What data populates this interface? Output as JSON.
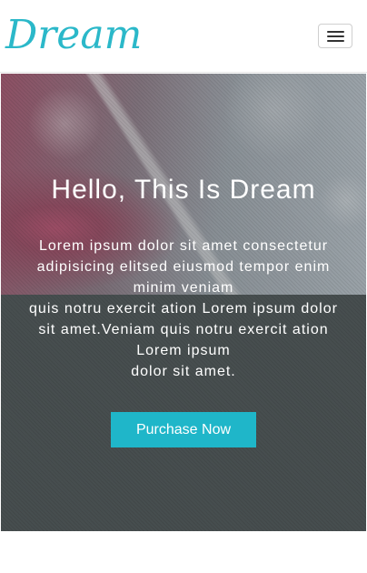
{
  "navbar": {
    "logo_text": "Dream",
    "menu_toggle_icon": "hamburger-menu-icon"
  },
  "hero": {
    "title": "Hello, This Is Dream",
    "paragraph_lines": [
      "Lorem ipsum dolor sit amet consectetur adipisicing elitsed eiusmod tempor enim minim veniam",
      "quis notru exercit ation Lorem ipsum dolor sit amet.Veniam quis notru exercit ation Lorem ipsum",
      "dolor sit amet."
    ],
    "button_label": "Purchase Now"
  },
  "colors": {
    "brand_teal": "#1fb6c9",
    "logo_teal": "#2bb8c9",
    "overlay_gray": "#4c5556"
  }
}
